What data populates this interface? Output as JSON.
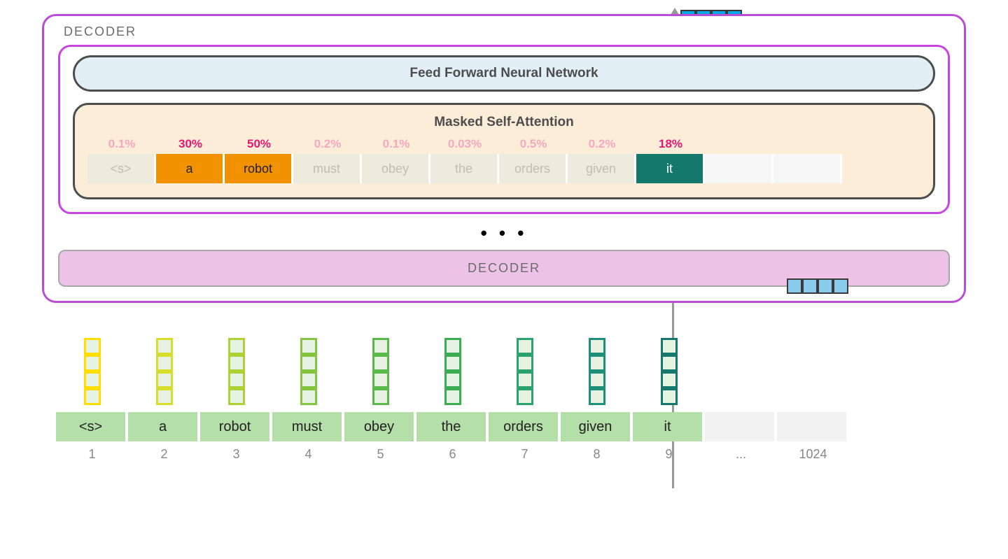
{
  "outer_label": "DECODER",
  "ffn_label": "Feed Forward Neural Network",
  "msa_label": "Masked Self-Attention",
  "attention": {
    "percentages": [
      "0.1%",
      "30%",
      "50%",
      "0.2%",
      "0.1%",
      "0.03%",
      "0.5%",
      "0.2%",
      "18%"
    ],
    "tokens": [
      "<s>",
      "a",
      "robot",
      "must",
      "obey",
      "the",
      "orders",
      "given",
      "it"
    ],
    "styles": [
      "dim",
      "hi",
      "hi",
      "dim",
      "dim",
      "dim",
      "dim",
      "dim",
      "current",
      "empty",
      "empty"
    ],
    "pct_styles": [
      "low",
      "high",
      "high",
      "low",
      "low",
      "low",
      "low",
      "low",
      "high"
    ]
  },
  "dots": "• • •",
  "decoder_bar_label": "DECODER",
  "input_tokens": [
    "<s>",
    "a",
    "robot",
    "must",
    "obey",
    "the",
    "orders",
    "given",
    "it"
  ],
  "positions": [
    "1",
    "2",
    "3",
    "4",
    "5",
    "6",
    "7",
    "8",
    "9",
    "...",
    "1024"
  ]
}
